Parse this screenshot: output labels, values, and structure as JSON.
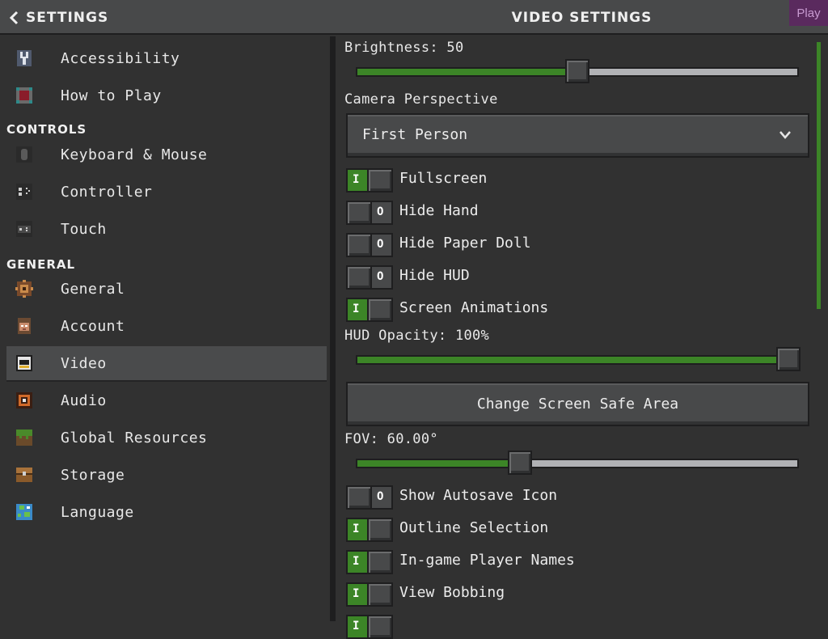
{
  "header": {
    "back_label": "SETTINGS",
    "title": "VIDEO SETTINGS",
    "badge": "Play"
  },
  "sidebar": {
    "top_items": [
      {
        "label": "Accessibility",
        "icon": "wrench-icon"
      },
      {
        "label": "How to Play",
        "icon": "book-icon"
      }
    ],
    "controls_header": "CONTROLS",
    "controls_items": [
      {
        "label": "Keyboard & Mouse",
        "icon": "mouse-icon"
      },
      {
        "label": "Controller",
        "icon": "controller-icon"
      },
      {
        "label": "Touch",
        "icon": "touch-icon"
      }
    ],
    "general_header": "GENERAL",
    "general_items": [
      {
        "label": "General",
        "icon": "gear-icon"
      },
      {
        "label": "Account",
        "icon": "account-icon"
      },
      {
        "label": "Video",
        "icon": "video-icon",
        "selected": true
      },
      {
        "label": "Audio",
        "icon": "audio-icon"
      },
      {
        "label": "Global Resources",
        "icon": "grass-block-icon"
      },
      {
        "label": "Storage",
        "icon": "chest-icon"
      },
      {
        "label": "Language",
        "icon": "globe-icon"
      }
    ]
  },
  "video": {
    "brightness_label": "Brightness: 50",
    "brightness_value": 0.5,
    "camera_label": "Camera Perspective",
    "camera_value": "First Person",
    "toggles_a": [
      {
        "label": "Fullscreen",
        "on": true
      },
      {
        "label": "Hide Hand",
        "on": false
      },
      {
        "label": "Hide Paper Doll",
        "on": false
      },
      {
        "label": "Hide HUD",
        "on": false
      },
      {
        "label": "Screen Animations",
        "on": true
      }
    ],
    "hud_label": "HUD Opacity: 100%",
    "hud_value": 1.0,
    "safe_area_button": "Change Screen Safe Area",
    "fov_label": "FOV: 60.00°",
    "fov_value": 0.37,
    "toggles_b": [
      {
        "label": "Show Autosave Icon",
        "on": false
      },
      {
        "label": "Outline Selection",
        "on": true
      },
      {
        "label": "In-game Player Names",
        "on": true
      },
      {
        "label": "View Bobbing",
        "on": true
      },
      {
        "label": "",
        "on": true
      }
    ]
  },
  "colors": {
    "accent_green": "#3c8527",
    "panel_bg": "#313131",
    "header_bg": "#48494a"
  }
}
